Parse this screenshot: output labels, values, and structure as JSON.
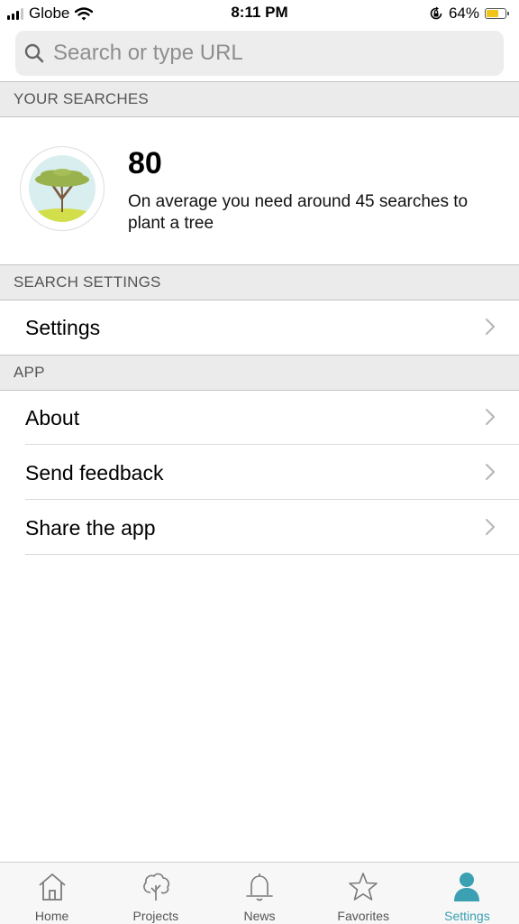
{
  "status_bar": {
    "carrier": "Globe",
    "time": "8:11 PM",
    "battery_percent": "64%",
    "battery_level": 0.64,
    "battery_color": "#f0c419"
  },
  "search": {
    "placeholder": "Search or type URL",
    "value": ""
  },
  "your_searches": {
    "header": "YOUR SEARCHES",
    "count": "80",
    "description": "On average you need around 45 searches to plant a tree"
  },
  "search_settings": {
    "header": "SEARCH SETTINGS",
    "items": [
      {
        "label": "Settings"
      }
    ]
  },
  "app_section": {
    "header": "APP",
    "items": [
      {
        "label": "About"
      },
      {
        "label": "Send feedback"
      },
      {
        "label": "Share the app"
      }
    ]
  },
  "tab_bar": {
    "active_color": "#3aa0b2",
    "tabs": [
      {
        "label": "Home",
        "icon": "home-icon"
      },
      {
        "label": "Projects",
        "icon": "tree-icon"
      },
      {
        "label": "News",
        "icon": "bell-icon"
      },
      {
        "label": "Favorites",
        "icon": "star-icon"
      },
      {
        "label": "Settings",
        "icon": "person-icon",
        "active": true
      }
    ]
  }
}
